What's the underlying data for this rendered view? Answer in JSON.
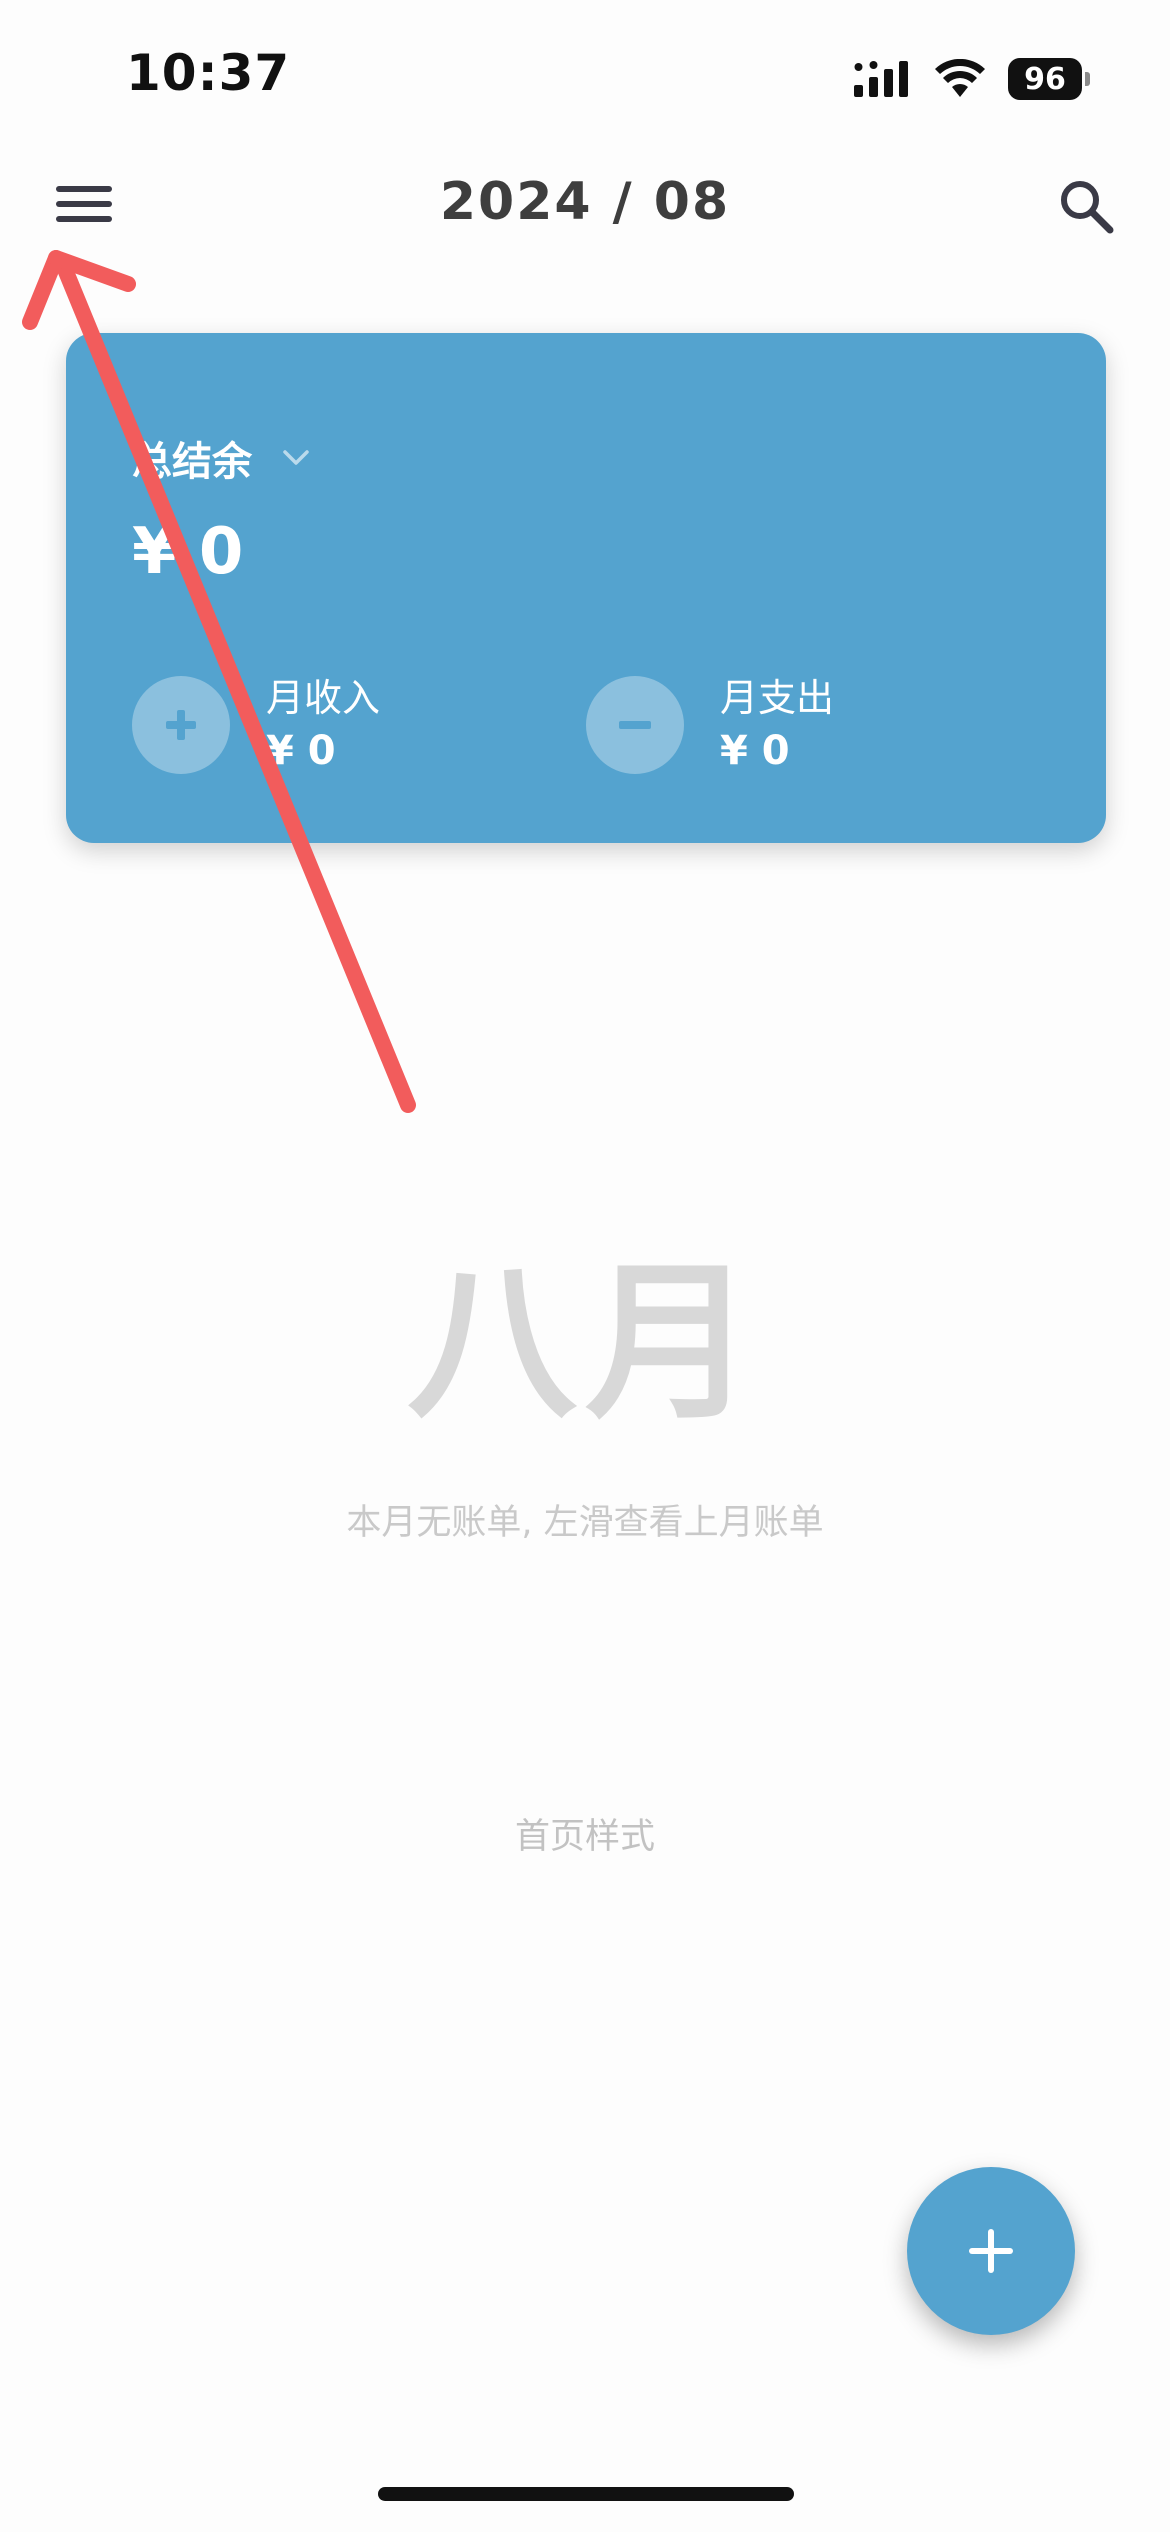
{
  "status_bar": {
    "time": "10:37",
    "battery_level": "96",
    "icons": [
      "signal-icon",
      "wifi-icon",
      "battery-icon"
    ]
  },
  "nav": {
    "title": "2024 / 08",
    "menu_icon": "menu-icon",
    "search_icon": "search-icon"
  },
  "balance_card": {
    "label": "总结余",
    "amount": "¥ 0",
    "income": {
      "label": "月收入",
      "value": "¥ 0",
      "icon": "plus-icon"
    },
    "expense": {
      "label": "月支出",
      "value": "¥ 0",
      "icon": "minus-icon"
    }
  },
  "empty_state": {
    "month": "八月",
    "hint": "本月无账单, 左滑查看上月账单"
  },
  "home_style_label": "首页样式",
  "fab": {
    "icon": "plus-icon"
  },
  "colors": {
    "accent": "#54a3cf",
    "annotation": "#f25c5c",
    "title_text": "#3e3e3e",
    "muted_text": "#c9c9c9"
  }
}
